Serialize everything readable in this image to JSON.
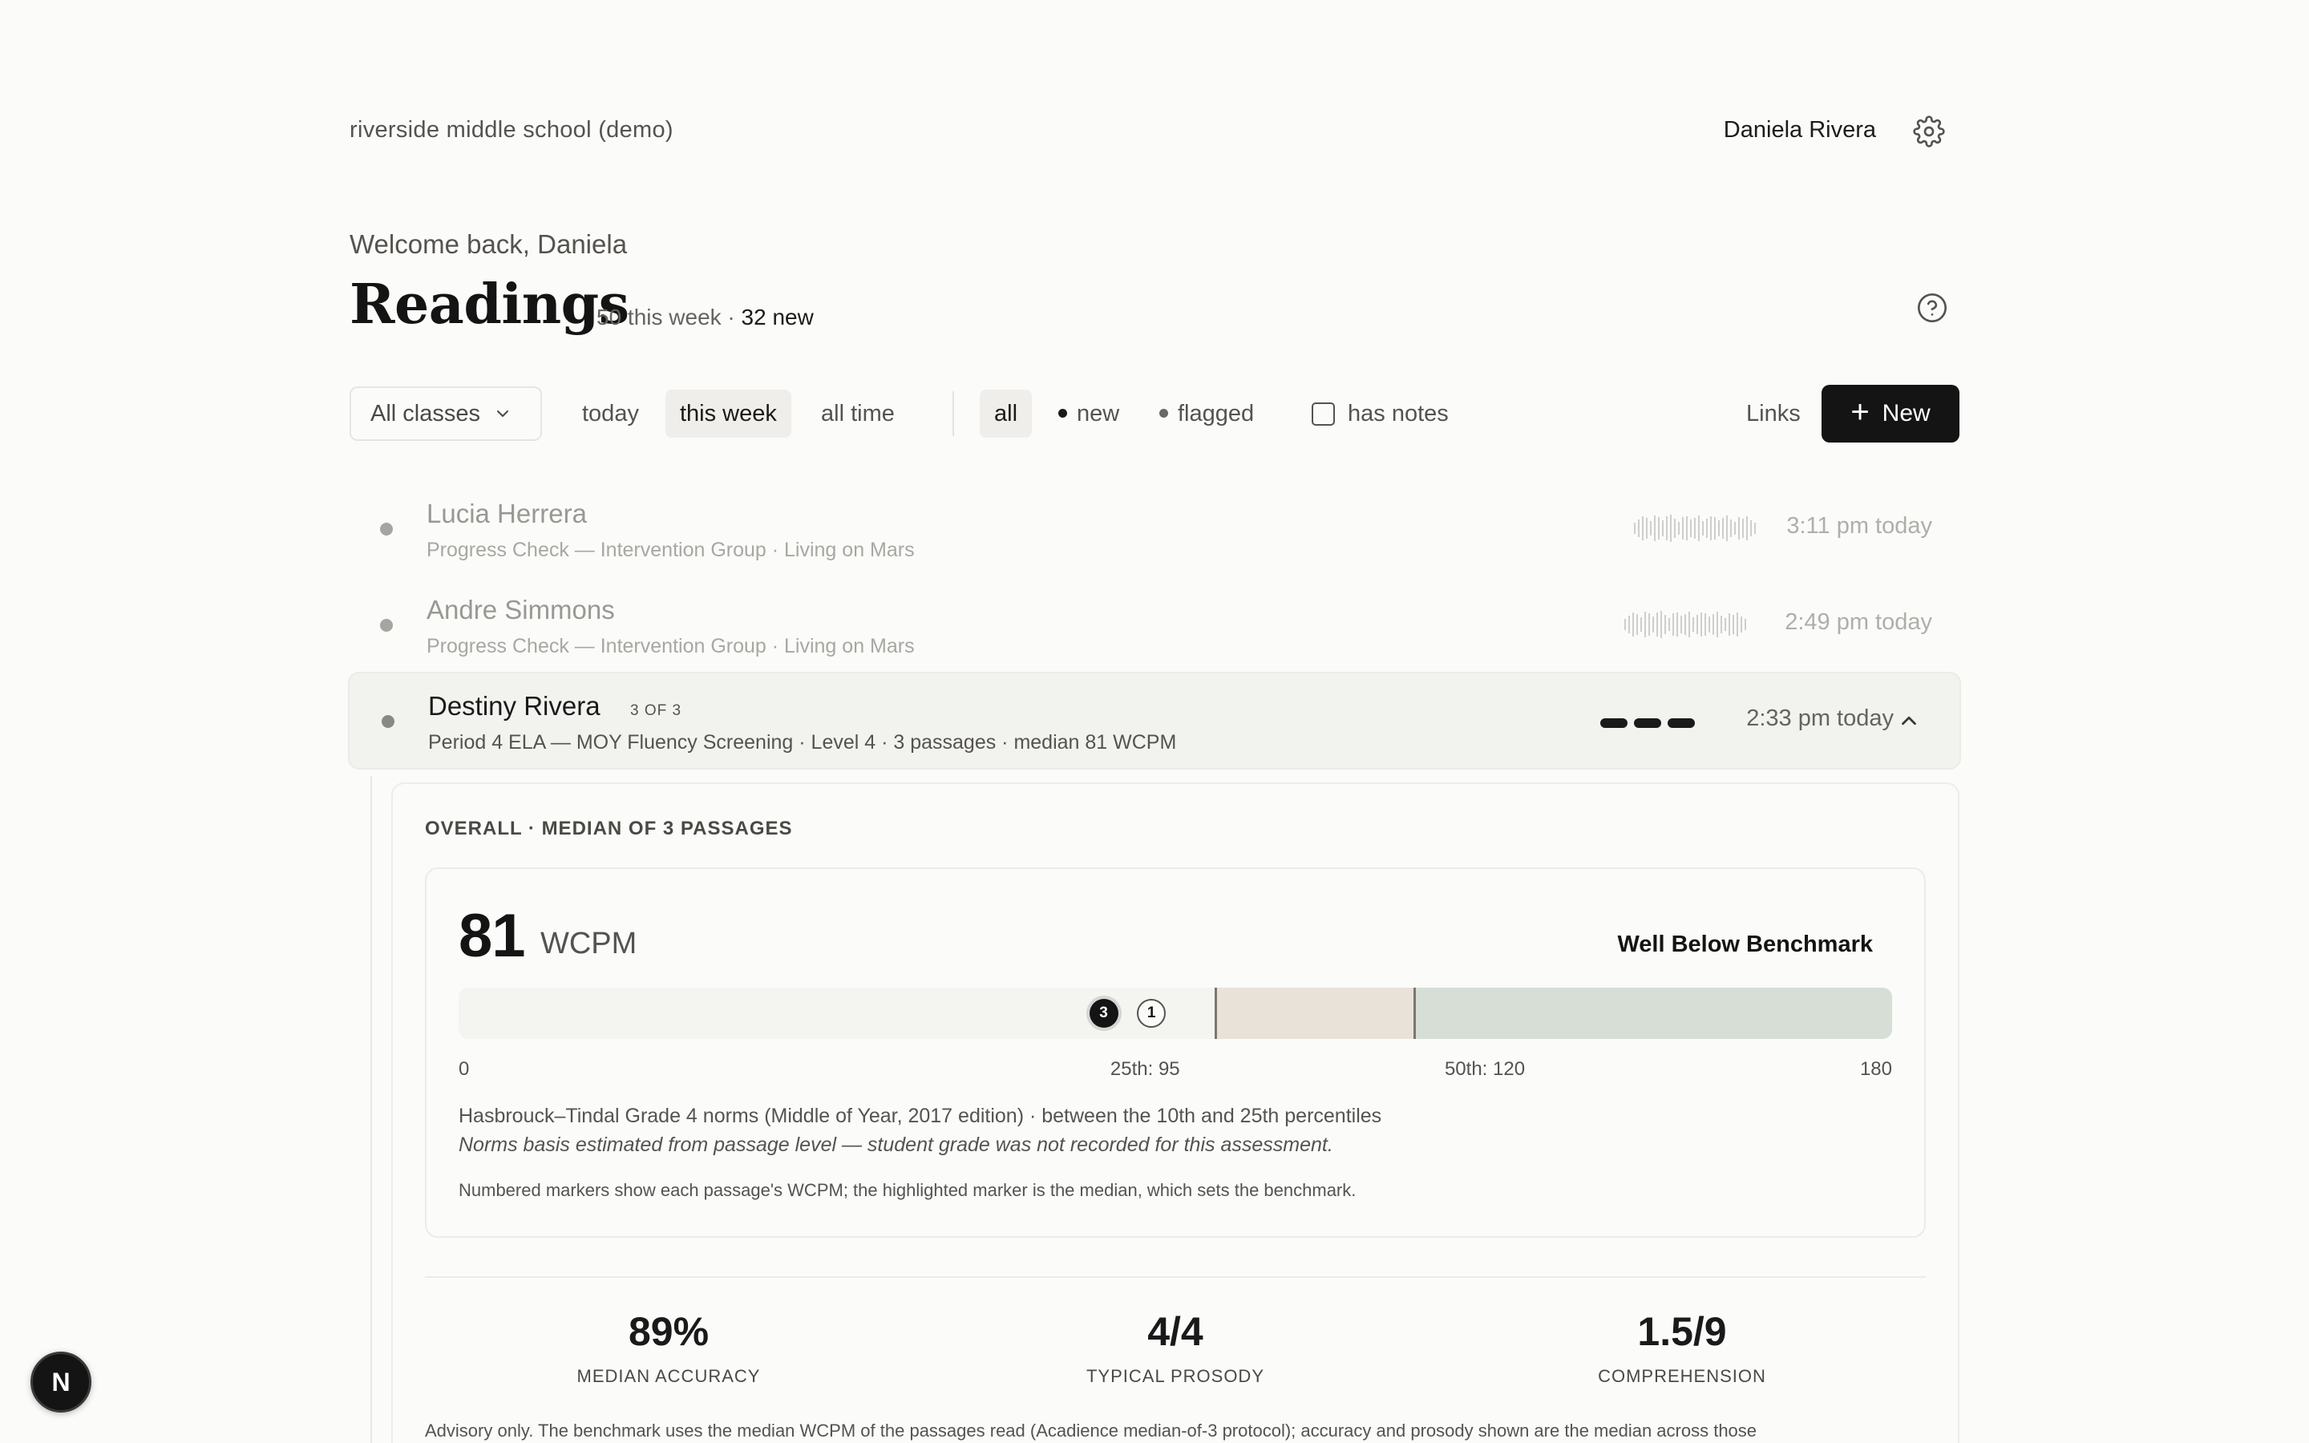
{
  "header": {
    "school": "riverside middle school (demo)",
    "user": "Daniela Rivera"
  },
  "page": {
    "welcome": "Welcome back, Daniela",
    "title": "Readings",
    "week_count": "50 this week",
    "separator": "·",
    "new_count": "32 new"
  },
  "filters": {
    "class_select": "All classes",
    "time": [
      {
        "label": "today",
        "active": false
      },
      {
        "label": "this week",
        "active": true
      },
      {
        "label": "all time",
        "active": false
      }
    ],
    "status": [
      {
        "label": "all",
        "active": true
      },
      {
        "label": "new",
        "active": false
      },
      {
        "label": "flagged",
        "active": false
      }
    ],
    "has_notes": "has notes",
    "has_notes_checked": false,
    "links": "Links",
    "new_button": "New"
  },
  "rows": [
    {
      "name": "Lucia Herrera",
      "meta": "Progress Check — Intervention Group · Living on Mars",
      "time": "3:11 pm today"
    },
    {
      "name": "Andre Simmons",
      "meta": "Progress Check — Intervention Group · Living on Mars",
      "time": "2:49 pm today"
    },
    {
      "name": "Destiny Rivera",
      "of": "3 OF 3",
      "meta": "Period 4 ELA — MOY Fluency Screening · Level 4 · 3 passages · median 81 WCPM",
      "time": "2:33 pm today"
    }
  ],
  "detail": {
    "overall_label": "OVERALL · MEDIAN OF 3 PASSAGES",
    "wcpm_value": "81",
    "wcpm_unit": "WCPM",
    "benchmark": "Well Below Benchmark",
    "scale": {
      "min": 0,
      "max": 180,
      "p25": 95,
      "p50": 120,
      "min_label": "0",
      "max_label": "180",
      "p25_label": "25th: 95",
      "p50_label": "50th: 120",
      "markers": [
        {
          "label": "3",
          "wcpm": 81,
          "median": true
        },
        {
          "label": "1",
          "wcpm": 87,
          "median": false
        }
      ],
      "colors": {
        "track": "#f4f4f1",
        "some_risk": "#e9e2d9",
        "at_benchmark": "#d6ded6"
      }
    },
    "norms": "Hasbrouck–Tindal Grade 4 norms (Middle of Year, 2017 edition) · between the 10th and 25th percentiles",
    "norms_note": "Norms basis estimated from passage level — student grade was not recorded for this assessment.",
    "markers_note": "Numbered markers show each passage's WCPM; the highlighted marker is the median, which sets the benchmark.",
    "stats": [
      {
        "value": "89%",
        "label": "MEDIAN ACCURACY"
      },
      {
        "value": "4/4",
        "label": "TYPICAL PROSODY"
      },
      {
        "value": "1.5/9",
        "label": "COMPREHENSION"
      }
    ],
    "advisory": "Advisory only. The benchmark uses the median WCPM of the passages read (Acadience median-of-3 protocol); accuracy and prosody shown are the median across those"
  },
  "badge": "N"
}
